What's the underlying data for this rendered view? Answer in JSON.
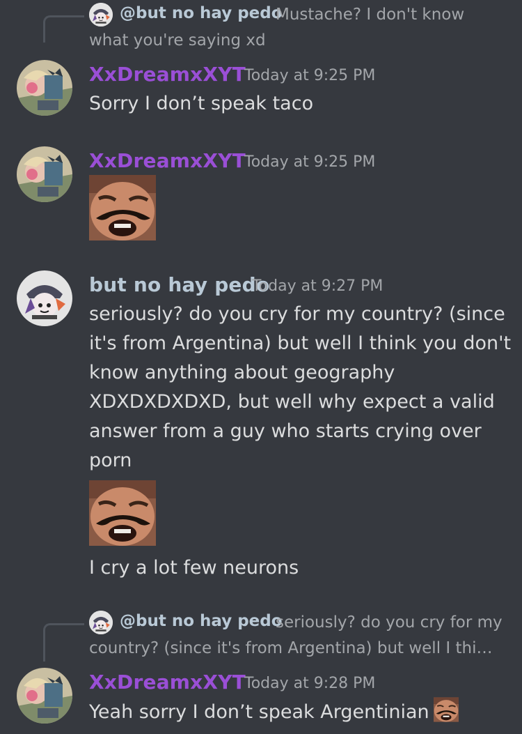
{
  "colors": {
    "background": "#36393f",
    "username_dream": "#9a4fd6",
    "username_pedo": "#b9c9d6",
    "text": "#dcddde",
    "muted": "#a3a6aa"
  },
  "messages": [
    {
      "reply": {
        "mention": "@but no hay pedo",
        "text_line1": "Mustache? I don't know",
        "text_line2": "what you're saying xd"
      },
      "author": "XxDreamxXYT",
      "timestamp": "Today at 9:25 PM",
      "text": "Sorry I don’t speak taco"
    },
    {
      "author": "XxDreamxXYT",
      "timestamp": "Today at 9:25 PM",
      "emoji": "laughing-man-emoji"
    },
    {
      "author": "but no hay pedo",
      "timestamp": "Today at 9:27 PM",
      "lines": [
        "seriously? do you cry for my country? (since",
        "it's from Argentina) but well I think you don't",
        "know anything about geography",
        "XDXDXDXDXD, but well why expect a valid",
        "answer from a guy who starts crying over",
        "porn"
      ],
      "emoji": "laughing-man-emoji",
      "text_after": "I cry a lot few neurons"
    },
    {
      "reply": {
        "mention": "@but no hay pedo",
        "text_line1": "seriously? do you cry for my",
        "text_line2": "country? (since it's from Argentina) but well I thi…"
      },
      "author": "XxDreamxXYT",
      "timestamp": "Today at 9:28 PM",
      "text": "Yeah sorry I don’t speak Argentinian",
      "emoji": "laughing-man-emoji"
    }
  ]
}
